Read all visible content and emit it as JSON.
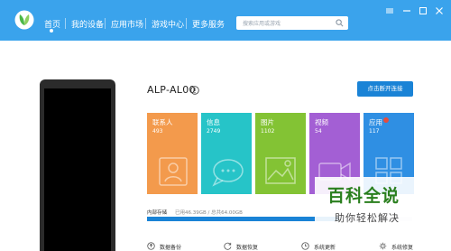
{
  "nav": {
    "items": [
      {
        "label": "首页",
        "active": true
      },
      {
        "label": "我的设备",
        "active": false
      },
      {
        "label": "应用市场",
        "active": false
      },
      {
        "label": "游戏中心",
        "active": false
      },
      {
        "label": "更多服务",
        "active": false
      }
    ],
    "search_placeholder": "搜索应用或游戏"
  },
  "device": {
    "name": "ALP-AL00",
    "connect_label": "点击断开连接"
  },
  "tiles": [
    {
      "label": "联系人",
      "count": "493",
      "color": "#f39a4c",
      "icon": "contact-card-icon"
    },
    {
      "label": "信息",
      "count": "2749",
      "color": "#26c4c8",
      "icon": "message-bubble-icon"
    },
    {
      "label": "图片",
      "count": "1102",
      "color": "#83c334",
      "icon": "picture-icon"
    },
    {
      "label": "视频",
      "count": "54",
      "color": "#a35fd4",
      "icon": "video-icon"
    },
    {
      "label": "应用",
      "count": "117",
      "color": "#2f8fe3",
      "icon": "app-grid-icon",
      "badge": true
    }
  ],
  "storage": {
    "label": "内部存储",
    "usage_text": "已用46.39GB / 总共64.00GB",
    "used_fraction": 0.725
  },
  "actions": [
    {
      "label": "数据备份",
      "icon": "backup-icon"
    },
    {
      "label": "数据恢复",
      "icon": "restore-icon"
    },
    {
      "label": "系统更新",
      "icon": "update-icon"
    },
    {
      "label": "系统修复",
      "icon": "repair-icon"
    }
  ],
  "watermark": {
    "title": "百科全说",
    "subtitle": "助你轻松解决"
  },
  "colors": {
    "topbar": "#3aa3ec",
    "primary": "#1a83d6"
  }
}
